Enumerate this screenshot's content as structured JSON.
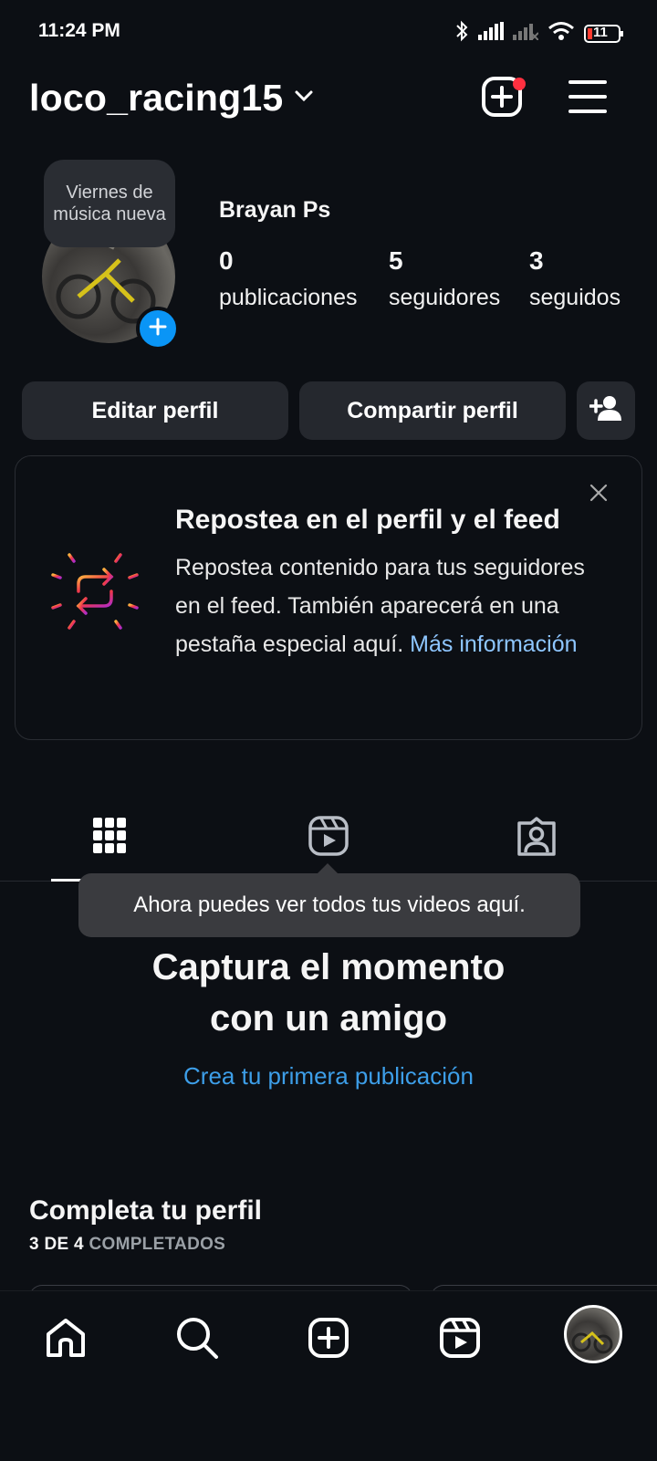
{
  "status_bar": {
    "time": "11:24 PM",
    "battery": "11"
  },
  "header": {
    "username": "loco_racing15"
  },
  "profile": {
    "note": "Viernes de música nueva",
    "full_name": "Brayan Ps",
    "stats": [
      {
        "value": "0",
        "label": "publicaciones"
      },
      {
        "value": "5",
        "label": "seguidores"
      },
      {
        "value": "3",
        "label": "seguidos"
      }
    ]
  },
  "actions": {
    "edit": "Editar perfil",
    "share": "Compartir perfil"
  },
  "repost_card": {
    "title": "Repostea en el perfil y el feed",
    "body": "Repostea contenido para tus seguidores en el feed. También aparecerá en una pestaña especial aquí.",
    "link": "Más información"
  },
  "tooltip": "Ahora puedes ver todos tus videos aquí.",
  "empty_state": {
    "title_line1": "Captura el momento",
    "title_line2": "con un amigo",
    "link": "Crea tu primera publicación"
  },
  "complete_profile": {
    "title": "Completa tu perfil",
    "progress_count": "3 DE 4",
    "progress_label": "COMPLETADOS"
  },
  "icons": {
    "bluetooth": "bluetooth-icon",
    "signal": "signal-icon",
    "wifi": "wifi-icon",
    "battery": "battery-icon",
    "create": "plus-square-icon",
    "menu": "hamburger-menu-icon",
    "add_person": "add-person-icon",
    "repost": "repost-icon",
    "close": "close-icon",
    "grid": "grid-icon",
    "reels": "reels-icon",
    "tagged": "tagged-icon",
    "home": "home-icon",
    "search": "search-icon"
  },
  "colors": {
    "background": "#0c0f14",
    "accent_blue": "#0a95f6",
    "link_blue": "#3d9ee8",
    "notification_red": "#ff3040"
  }
}
